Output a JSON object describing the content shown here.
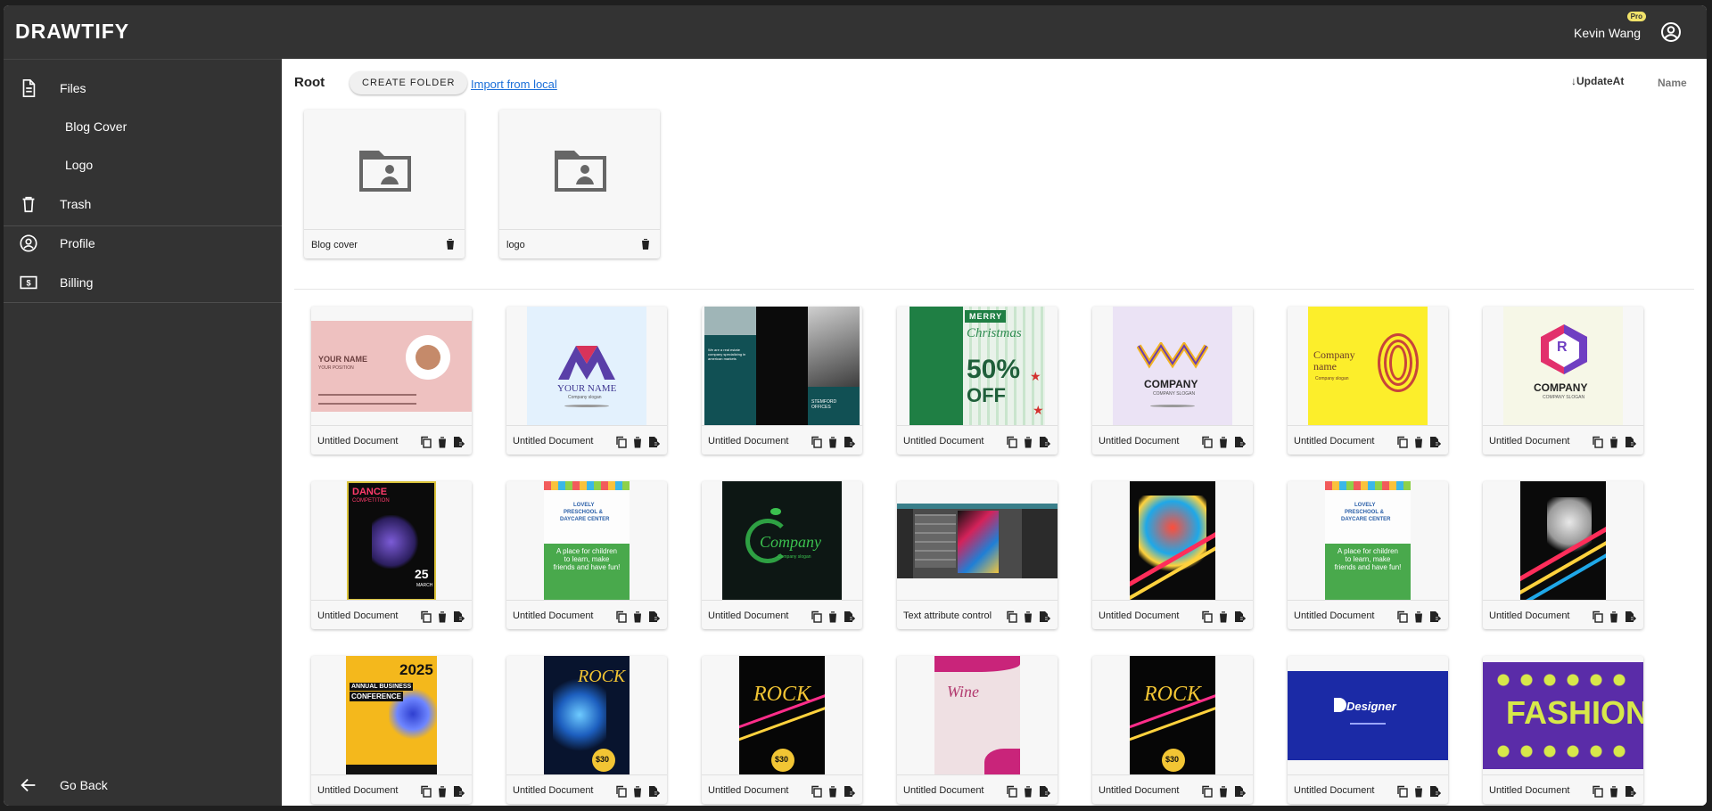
{
  "app": {
    "logo": "DRAWTIFY",
    "user_name": "Kevin Wang",
    "badge": "Pro"
  },
  "sidebar": {
    "files": "Files",
    "blog_cover": "Blog Cover",
    "logo": "Logo",
    "trash": "Trash",
    "profile": "Profile",
    "billing": "Billing",
    "go_back": "Go Back"
  },
  "toolbar": {
    "root": "Root",
    "create_folder": "CREATE FOLDER",
    "import": "Import from local",
    "sort_update": "UpdateAt",
    "sort_name": "Name"
  },
  "folders": [
    {
      "name": "Blog cover"
    },
    {
      "name": "logo"
    }
  ],
  "documents": [
    {
      "title": "Untitled Document",
      "art": "business-card",
      "texts": [
        "YOUR NAME",
        "YOUR POSITION"
      ]
    },
    {
      "title": "Untitled Document",
      "art": "m-logo",
      "texts": [
        "YOUR NAME",
        "Company slogan"
      ]
    },
    {
      "title": "Untitled Document",
      "art": "brochure",
      "texts": [
        "We are a real estate company specializing in american markets",
        "STEMFORD OFFICES"
      ]
    },
    {
      "title": "Untitled Document",
      "art": "christmas",
      "texts": [
        "MERRY",
        "Christmas",
        "50%",
        "OFF"
      ]
    },
    {
      "title": "Untitled Document",
      "art": "company-waves",
      "texts": [
        "COMPANY",
        "COMPANY SLOGAN"
      ]
    },
    {
      "title": "Untitled Document",
      "art": "fingerprint",
      "texts": [
        "Company name",
        "Company slogan"
      ]
    },
    {
      "title": "Untitled Document",
      "art": "r-logo",
      "texts": [
        "R",
        "COMPANY",
        "COMPANY SLOGAN"
      ]
    },
    {
      "title": "Untitled Document",
      "art": "dance",
      "texts": [
        "DANCE",
        "COMPETITION",
        "25",
        "MARCH"
      ]
    },
    {
      "title": "Untitled Document",
      "art": "preschool",
      "texts": [
        "LOVELY",
        "PRESCHOOL &",
        "DAYCARE CENTER",
        "A place for children to learn, make friends and have fun!"
      ]
    },
    {
      "title": "Untitled Document",
      "art": "company-leaf",
      "texts": [
        "Company",
        "Company slogan"
      ]
    },
    {
      "title": "Text attribute control",
      "art": "editor",
      "texts": []
    },
    {
      "title": "Untitled Document",
      "art": "neon-dance",
      "texts": []
    },
    {
      "title": "Untitled Document",
      "art": "preschool",
      "texts": [
        "LOVELY",
        "PRESCHOOL &",
        "DAYCARE CENTER",
        "A place for children to learn, make friends and have fun!"
      ]
    },
    {
      "title": "Untitled Document",
      "art": "neon-dance2",
      "texts": []
    },
    {
      "title": "Untitled Document",
      "art": "conference",
      "texts": [
        "2025",
        "ANNUAL BUSINESS",
        "CONFERENCE"
      ]
    },
    {
      "title": "Untitled Document",
      "art": "rock-blue",
      "texts": [
        "ROCK",
        "$30"
      ]
    },
    {
      "title": "Untitled Document",
      "art": "rock-black",
      "texts": [
        "ROCK",
        "$30"
      ]
    },
    {
      "title": "Untitled Document",
      "art": "wine",
      "texts": [
        "Wine"
      ]
    },
    {
      "title": "Untitled Document",
      "art": "rock-black",
      "texts": [
        "ROCK",
        "$30"
      ]
    },
    {
      "title": "Untitled Document",
      "art": "designer",
      "texts": [
        "Designer"
      ]
    },
    {
      "title": "Untitled Document",
      "art": "fashion",
      "texts": [
        "FASHION"
      ]
    }
  ],
  "colors": {
    "topbar": "#333333",
    "sidebar": "#333333",
    "link": "#1a6ed8",
    "badge": "#f1e36a"
  }
}
